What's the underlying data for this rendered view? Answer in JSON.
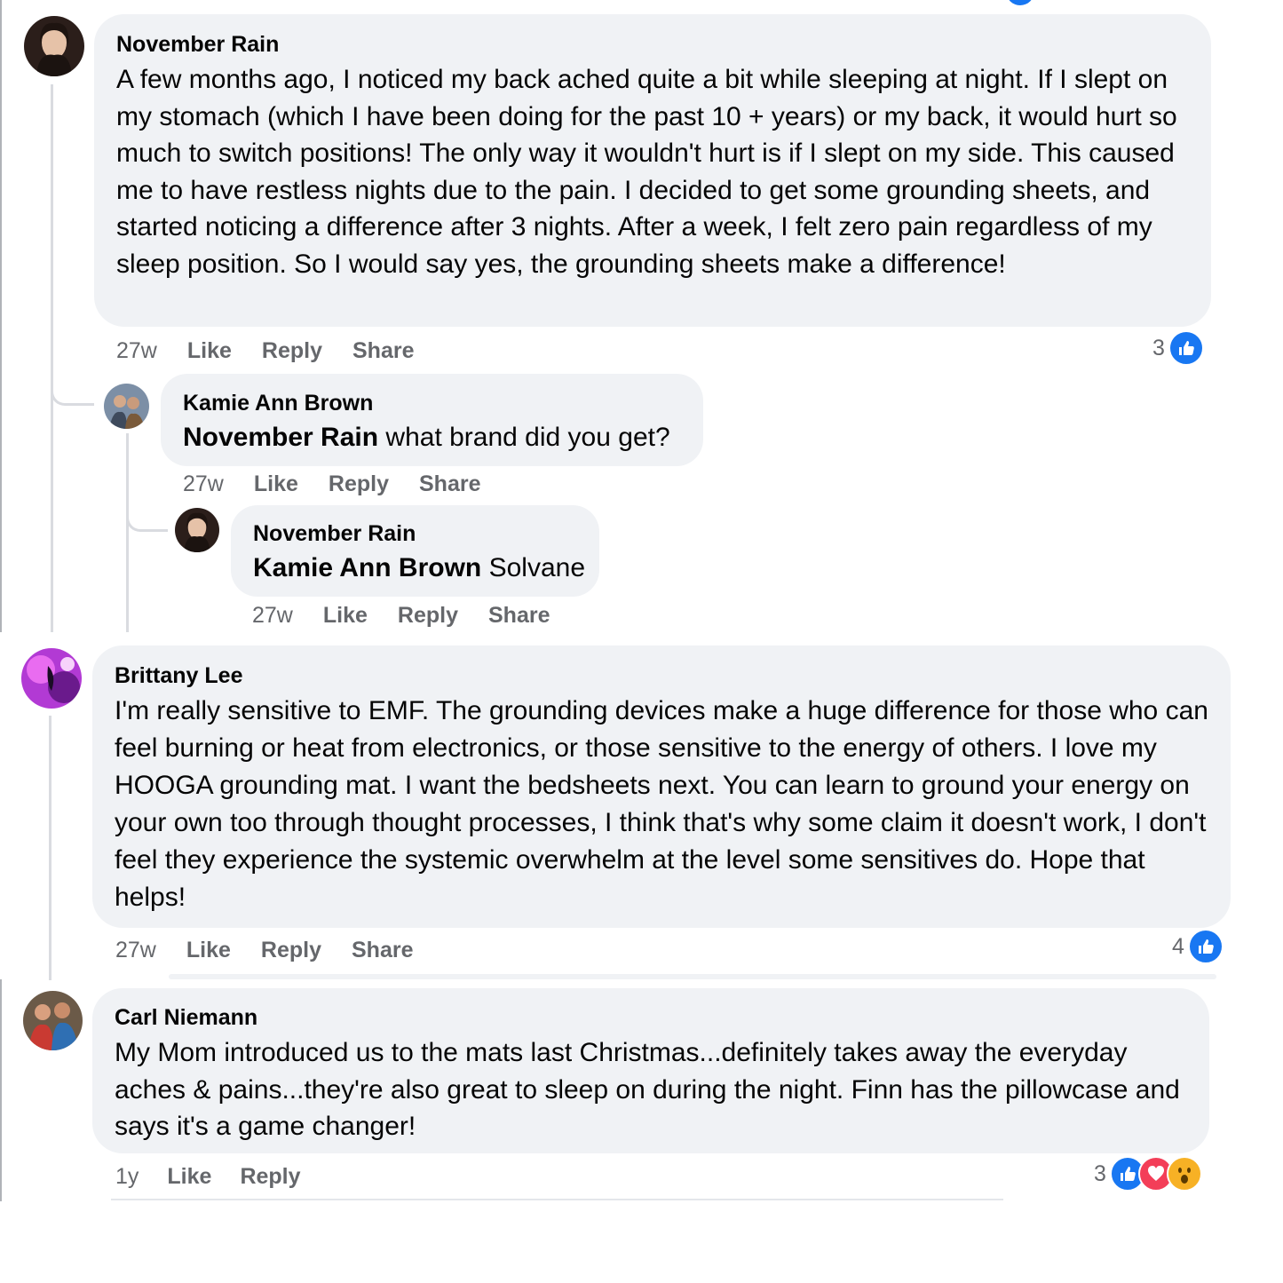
{
  "comments": [
    {
      "author": "November Rain",
      "text": "A few months ago, I noticed my back ached quite a bit while sleeping at night. If I slept on my stomach (which I have been doing for the past 10 + years) or my back, it would hurt so much to switch positions! The only way it wouldn't hurt is if I slept on my side. This caused me to have restless nights due to the pain. I decided to get some grounding sheets, and started noticing a difference after 3 nights. After a week, I felt zero pain regardless of my sleep position. So I would say yes, the grounding sheets make a difference!",
      "time": "27w",
      "like": "Like",
      "reply": "Reply",
      "share": "Share",
      "reaction_count": "3",
      "reactions": [
        "like-icon"
      ]
    },
    {
      "author": "Kamie Ann Brown",
      "mention": "November Rain",
      "text": " what brand did you get?",
      "time": "27w",
      "like": "Like",
      "reply": "Reply",
      "share": "Share"
    },
    {
      "author": "November Rain",
      "mention": "Kamie Ann Brown",
      "text": " Solvane",
      "time": "27w",
      "like": "Like",
      "reply": "Reply",
      "share": "Share"
    },
    {
      "author": "Brittany Lee",
      "text": "I'm really sensitive to EMF. The grounding devices make a huge difference for those who can feel burning or heat from electronics, or those sensitive to the energy of others. I love my HOOGA grounding mat. I want the bedsheets next. You can learn to ground your energy on your own too through thought processes, I think that's why some claim it doesn't work, I don't feel they experience the systemic overwhelm at the level some sensitives do. Hope that helps!",
      "time": "27w",
      "like": "Like",
      "reply": "Reply",
      "share": "Share",
      "reaction_count": "4",
      "reactions": [
        "like-icon"
      ]
    },
    {
      "author": "Carl Niemann",
      "text": "My Mom introduced us to the mats last Christmas...definitely takes away the everyday aches & pains...they're also great to sleep on during the night. Finn has the pillowcase and says it's a game changer!",
      "time": "1y",
      "like": "Like",
      "reply": "Reply",
      "reaction_count": "3",
      "reactions": [
        "like-icon",
        "love-icon",
        "wow-icon"
      ]
    }
  ],
  "colors": {
    "bubble": "#f0f2f5",
    "like_blue": "#1877f2",
    "love_red": "#f33e58",
    "wow_yellow": "#f7b125",
    "meta_gray": "#65676b"
  }
}
